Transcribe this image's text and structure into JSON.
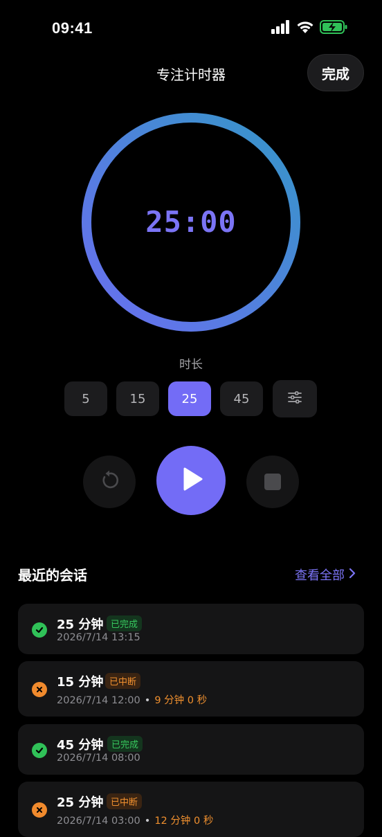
{
  "status_bar": {
    "time": "09:41",
    "icons": [
      "signal-icon",
      "wifi-icon",
      "battery-charging-icon"
    ],
    "battery_color": "#30c158"
  },
  "nav": {
    "title": "专注计时器",
    "done_label": "完成"
  },
  "timer": {
    "display": "25:00",
    "ring_progress": 1.0,
    "ring_gradient": [
      "#3596c8",
      "#6a6ef0"
    ]
  },
  "duration": {
    "label": "时长",
    "options": [
      "5",
      "15",
      "25",
      "45"
    ],
    "selected": "25",
    "settings_icon": "sliders-icon"
  },
  "controls": {
    "reset_icon": "reset-icon",
    "play_icon": "play-icon",
    "stop_icon": "stop-icon"
  },
  "recent": {
    "title": "最近的会话",
    "view_all": "查看全部",
    "sessions": [
      {
        "duration": "25 分钟",
        "status": "已完成",
        "status_type": "completed",
        "datetime": "2026/7/14 13:15",
        "elapsed": ""
      },
      {
        "duration": "15 分钟",
        "status": "已中断",
        "status_type": "interrupted",
        "datetime": "2026/7/14 12:00",
        "elapsed": "9 分钟 0 秒"
      },
      {
        "duration": "45 分钟",
        "status": "已完成",
        "status_type": "completed",
        "datetime": "2026/7/14 08:00",
        "elapsed": ""
      },
      {
        "duration": "25 分钟",
        "status": "已中断",
        "status_type": "interrupted",
        "datetime": "2026/7/14 03:00",
        "elapsed": "12 分钟 0 秒"
      }
    ]
  },
  "colors": {
    "accent": "#736cf6",
    "completed": "#30c158",
    "interrupted": "#f08a2d",
    "card": "#151516"
  }
}
